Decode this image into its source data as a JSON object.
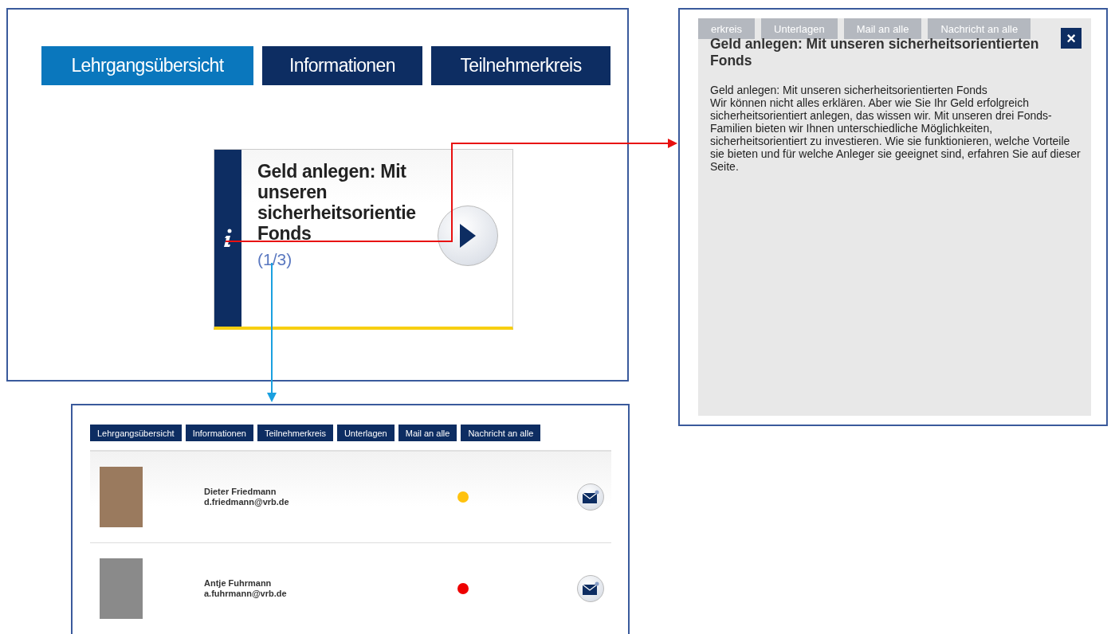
{
  "course_view": {
    "tabs": [
      {
        "label": "Lehrgangsübersicht",
        "selected": true
      },
      {
        "label": "Informationen",
        "selected": false
      },
      {
        "label": "Teilnehmerkreis",
        "selected": false
      }
    ],
    "info_card": {
      "title": "Geld anlegen: Mit unseren sicherheitsorientie Fonds",
      "counter": "(1/3)"
    }
  },
  "info_dialog": {
    "background_tabs": [
      "erkreis",
      "Unterlagen",
      "Mail an alle",
      "Nachricht an alle"
    ],
    "title": "Geld anlegen: Mit unseren sicherheitsorientierten Fonds",
    "close": "×",
    "subtitle": "Geld anlegen: Mit unseren sicherheitsorientierten Fonds",
    "text": "Wir können nicht alles erklären. Aber wie Sie Ihr Geld erfolgreich sicherheitsorientiert anlegen, das wissen wir. Mit unseren drei Fonds-Familien bieten wir Ihnen unterschiedliche Möglichkeiten, sicherheitsorientiert zu investieren. Wie sie funktionieren, welche Vorteile sie bieten und für welche Anleger sie geeignet sind, erfahren Sie auf dieser Seite."
  },
  "participants_view": {
    "tabs": [
      {
        "label": "Lehrgangsübersicht",
        "selected": false
      },
      {
        "label": "Informationen",
        "selected": false
      },
      {
        "label": "Teilnehmerkreis",
        "selected": false
      },
      {
        "label": "Unterlagen",
        "selected": false
      },
      {
        "label": "Mail an alle",
        "selected": false
      },
      {
        "label": "Nachricht an alle",
        "selected": false
      }
    ],
    "participants": [
      {
        "name": "Dieter Friedmann",
        "email": "d.friedmann@vrb.de",
        "color": "#ffc20e"
      },
      {
        "name": "Antje Fuhrmann",
        "email": "a.fuhrmann@vrb.de",
        "color": "#ee0000"
      }
    ]
  }
}
